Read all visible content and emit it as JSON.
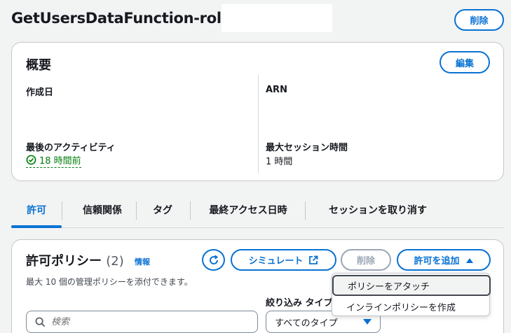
{
  "header": {
    "title": "GetUsersDataFunction-role-",
    "delete_label": "削除"
  },
  "summary": {
    "title": "概要",
    "edit_label": "編集",
    "created_label": "作成日",
    "arn_label": "ARN",
    "last_activity_label": "最後のアクティビティ",
    "last_activity_value": "18 時間前",
    "max_session_label": "最大セッション時間",
    "max_session_value": "1 時間"
  },
  "tabs": [
    {
      "label": "許可"
    },
    {
      "label": "信頼関係"
    },
    {
      "label": "タグ"
    },
    {
      "label": "最終アクセス日時"
    },
    {
      "label": "セッションを取り消す"
    }
  ],
  "policies": {
    "title": "許可ポリシー",
    "count": "(2)",
    "info_label": "情報",
    "description": "最大 10 個の管理ポリシーを添付できます。",
    "simulate_label": "シミュレート",
    "delete_label": "削除",
    "add_label": "許可を追加",
    "filter_label": "絞り込み タイプ",
    "search_placeholder": "検索",
    "type_selected": "すべてのタイプ"
  },
  "dropdown": {
    "items": [
      {
        "label": "ポリシーをアタッチ"
      },
      {
        "label": "インラインポリシーを作成"
      }
    ]
  },
  "colors": {
    "accent": "#0972d3",
    "success": "#037f0c",
    "disabled": "#9ba7b6"
  }
}
